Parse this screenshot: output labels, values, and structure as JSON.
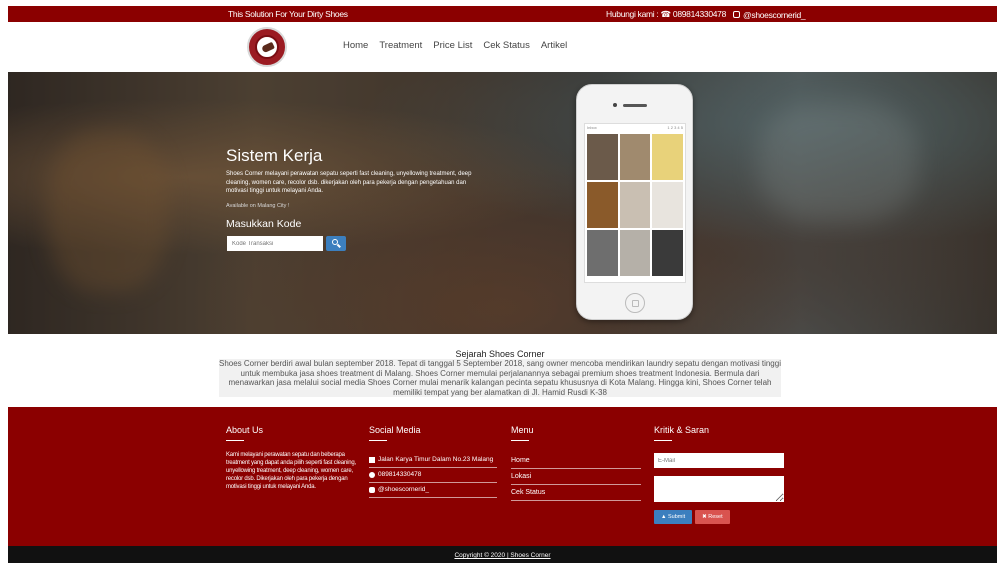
{
  "topbar": {
    "tagline": "This Solution For Your Dirty Shoes",
    "contact": "Hubungi kami : ☎ 089814330478",
    "phone_text": "Hubungi kami : ☎ 089814330478",
    "instagram": "@shoescornerid_",
    "bg_color": "#8b0000"
  },
  "nav": {
    "logo_icon": "shoe-logo-icon",
    "items": [
      "Home",
      "Treatment",
      "Price List",
      "Cek Status",
      "Artikel"
    ]
  },
  "hero": {
    "title": "Sistem Kerja",
    "description": "Shoes Corner melayani perawatan sepatu seperti fast cleaning, unyellowing treatment, deep cleaning, women care, recolor dsb. dikerjakan oleh para pekerja dengan pengetahuan dan motivasi tinggi untuk melayani Anda.",
    "availability": "Available on Malang City !",
    "code_label": "Masukkan Kode",
    "code_placeholder": "Kode Transaksi",
    "search_icon": "search-icon"
  },
  "phone_mock": {
    "status_left": "Inbox",
    "status_right": "1 2 3 4 5",
    "tiles": [
      "#6b5a4a",
      "#a08a6e",
      "#e8d27a",
      "#8a5a2a",
      "#c9bfb2",
      "#e8e4de",
      "#6e6e6e",
      "#b5b0a8",
      "#3a3a3a"
    ]
  },
  "history": {
    "title": "Sejarah Shoes Corner",
    "body": "Shoes Corner berdiri awal bulan september 2018. Tepat di tanggal 5 September 2018, sang owner mencoba mendirikan laundry sepatu dengan motivasi tinggi untuk membuka jasa shoes treatment di Malang. Shoes Corner memulai perjalanannya sebagai premium shoes treatment Indonesia. Bermula dari menawarkan jasa melalui social media Shoes Corner mulai menarik kalangan pecinta sepatu khususnya di Kota Malang. Hingga kini, Shoes Corner telah memiliki tempat yang ber alamatkan di Jl. Hamid Rusdi K-38"
  },
  "footer": {
    "about": {
      "title": "About Us",
      "text": "Kami melayani perawatan sepatu dan beberapa treatment yang dapat anda pilih seperti fast cleaning, unyellowing treatment, deep cleaning, women care, recolor dsb. Dikerjakan oleh para pekerja dengan motivasi tinggi untuk melayani Anda."
    },
    "social": {
      "title": "Social Media",
      "address": "Jalan Karya Timur Dalam No.23 Malang",
      "whatsapp": "089814330478",
      "instagram": "@shoescornerid_"
    },
    "menu": {
      "title": "Menu",
      "items": [
        "Home",
        "Lokasi",
        "Cek Status"
      ]
    },
    "kritik": {
      "title": "Kritik & Saran",
      "email_placeholder": "E-Mail",
      "submit_label": "Submit",
      "reset_label": "Reset"
    },
    "copyright": "Copyright © 2020 | Shoes Corner"
  }
}
